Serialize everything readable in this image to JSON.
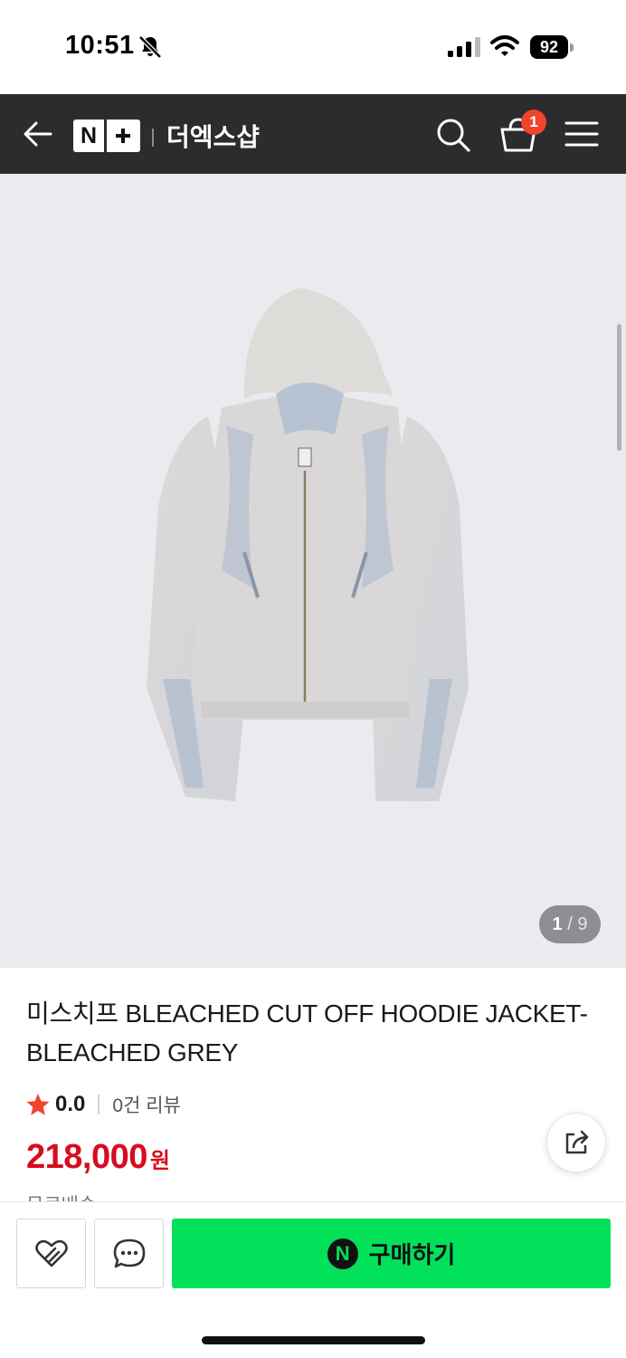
{
  "status_bar": {
    "time": "10:51",
    "battery": "92"
  },
  "header": {
    "logo_letter": "N",
    "brand_name": "더엑스샵",
    "cart_count": "1"
  },
  "gallery": {
    "current": "1",
    "separator": "/",
    "total": "9"
  },
  "product": {
    "title": "미스치프 BLEACHED CUT OFF HOODIE JACKET-BLEACHED GREY",
    "rating": "0.0",
    "review_count": "0건 리뷰",
    "price": "218,000",
    "currency": "원",
    "shipping_peek": "무료배송"
  },
  "actions": {
    "npay_letter": "N",
    "buy_label": "구매하기"
  },
  "colors": {
    "header_bg": "#2b2c2e",
    "price_red": "#d80b1f",
    "buy_green": "#03e15b",
    "badge_red": "#f0442c",
    "star_red": "#f0442c"
  },
  "icons": [
    "bell-off-icon",
    "signal-icon",
    "wifi-icon",
    "battery-icon",
    "back-arrow-icon",
    "search-icon",
    "cart-icon",
    "menu-icon",
    "star-icon",
    "share-icon",
    "heart-icon",
    "chat-icon",
    "naver-pay-icon"
  ]
}
